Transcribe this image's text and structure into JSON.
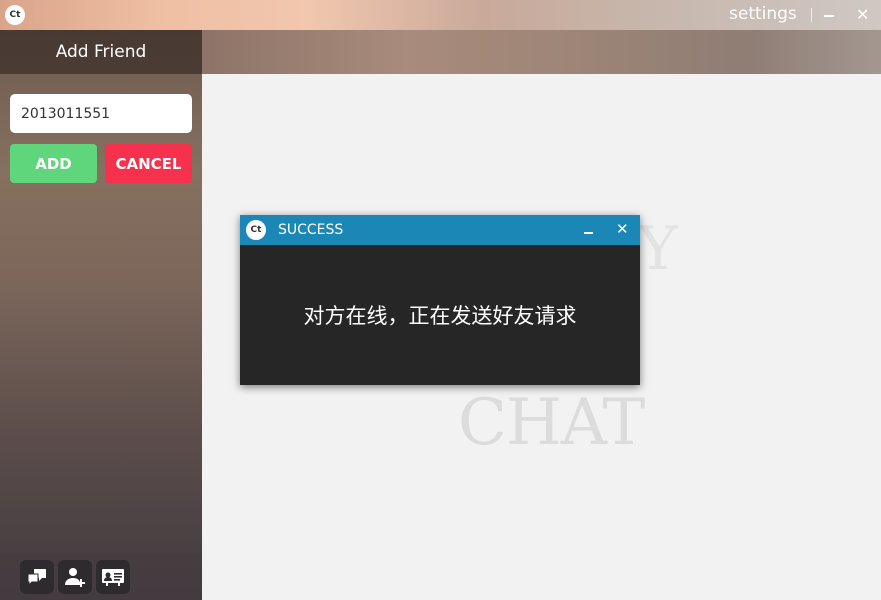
{
  "app": {
    "logo_text": "Ct",
    "settings_label": "settings"
  },
  "sidebar": {
    "title": "Add Friend",
    "input_value": "2013011551",
    "add_label": "ADD",
    "cancel_label": "CANCEL",
    "footer_icons": [
      "chat-bubbles-icon",
      "add-user-icon",
      "contact-card-icon"
    ]
  },
  "main": {
    "watermark_top": "Y",
    "watermark_bottom": "CHAT"
  },
  "dialog": {
    "logo_text": "Ct",
    "title": "SUCCESS",
    "message": "对方在线，正在发送好友请求"
  },
  "colors": {
    "add_button": "#5fd67c",
    "cancel_button": "#f5314e",
    "dialog_title_bar": "#1b87b6",
    "dialog_body": "#262626"
  }
}
